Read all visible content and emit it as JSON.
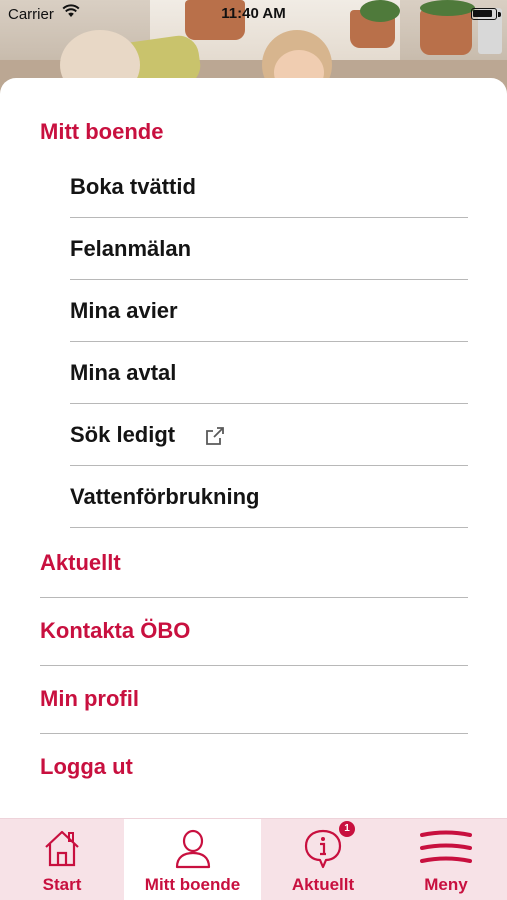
{
  "status_bar": {
    "carrier": "Carrier",
    "time": "11:40 AM"
  },
  "menu": {
    "section_title": "Mitt boende",
    "sub_items": [
      {
        "label": "Boka tvättid",
        "external": false
      },
      {
        "label": "Felanmälan",
        "external": false
      },
      {
        "label": "Mina avier",
        "external": false
      },
      {
        "label": "Mina avtal",
        "external": false
      },
      {
        "label": "Sök ledigt",
        "external": true,
        "icon": "external-link-icon"
      },
      {
        "label": "Vattenförbrukning",
        "external": false
      }
    ],
    "top_items": [
      {
        "label": "Aktuellt"
      },
      {
        "label": "Kontakta ÖBO"
      },
      {
        "label": "Min profil"
      },
      {
        "label": "Logga ut"
      }
    ]
  },
  "tabbar": {
    "tabs": [
      {
        "label": "Start",
        "icon": "house-icon",
        "active": false
      },
      {
        "label": "Mitt boende",
        "icon": "person-icon",
        "active": true
      },
      {
        "label": "Aktuellt",
        "icon": "info-bubble-icon",
        "active": false,
        "badge": "1"
      },
      {
        "label": "Meny",
        "icon": "hamburger-icon",
        "active": false
      }
    ]
  },
  "colors": {
    "accent": "#c8103f",
    "tabbar_bg": "#f7e2e7",
    "divider": "#b8b8b8",
    "text": "#141414"
  }
}
